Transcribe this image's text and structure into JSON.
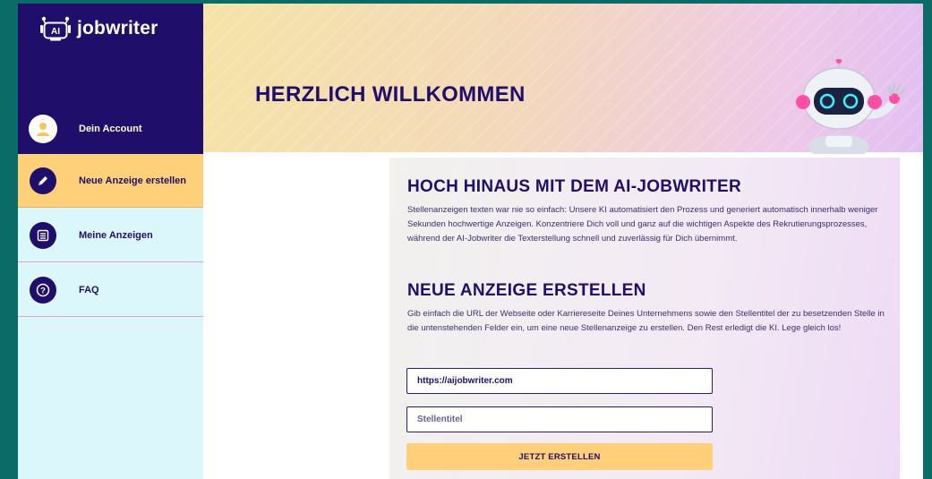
{
  "brand": {
    "name": "jobwriter",
    "badge": "AI"
  },
  "sidebar": {
    "account_label": "Dein Account",
    "items": [
      {
        "label": "Neue Anzeige erstellen",
        "icon": "pencil-icon",
        "active": true
      },
      {
        "label": "Meine Anzeigen",
        "icon": "list-icon",
        "active": false
      },
      {
        "label": "FAQ",
        "icon": "question-icon",
        "active": false
      }
    ]
  },
  "header": {
    "title": "HERZLICH WILLKOMMEN"
  },
  "main": {
    "intro_title": "HOCH HINAUS MIT DEM AI-JOBWRITER",
    "intro_text": "Stellenanzeigen texten war nie so einfach: Unsere KI automatisiert den Prozess und generiert automatisch innerhalb weniger Sekunden hochwertige Anzeigen. Konzentriere Dich voll und ganz auf die wichtigen Aspekte des Rekrutierungsprozesses, während der AI-Jobwriter die Texterstellung schnell und zuverlässig für Dich übernimmt.",
    "form_title": "NEUE ANZEIGE ERSTELLEN",
    "form_text": "Gib einfach die URL der Webseite oder Karriereseite Deines Unternehmens sowie den Stellentitel der zu besetzenden Stelle in die untenstehenden Felder ein, um eine neue Stellenanzeige zu erstellen. Den Rest erledigt die KI. Lege gleich los!",
    "url_value": "https://aijobwriter.com",
    "title_placeholder": "Stellentitel",
    "submit_label": "JETZT ERSTELLEN"
  },
  "colors": {
    "primary": "#1f0f6b",
    "accent": "#ffd07a",
    "sidebar_bg": "#dbf7fb",
    "frame_bg": "#0b6b66"
  }
}
